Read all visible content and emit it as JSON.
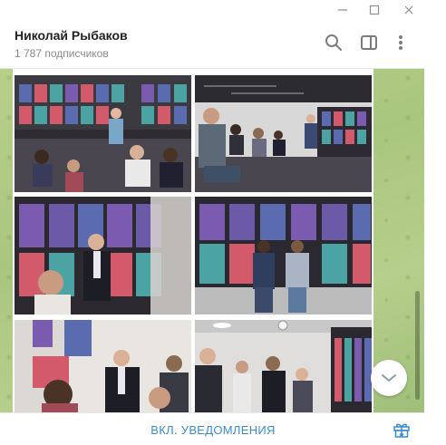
{
  "window": {
    "minimize_icon": "minimize-icon",
    "maximize_icon": "maximize-icon",
    "close_icon": "close-icon"
  },
  "header": {
    "title": "Николай Рыбаков",
    "subtitle": "1 787 подписчиков",
    "search_icon": "search-icon",
    "sidebar_icon": "sidebar-toggle-icon",
    "more_icon": "more-vertical-icon"
  },
  "album": {
    "photos": [
      {
        "description_icon": "photo-audience-exhibition"
      },
      {
        "description_icon": "photo-speaker-hall"
      },
      {
        "description_icon": "photo-speaker-microphone"
      },
      {
        "description_icon": "photo-visitors-stands"
      },
      {
        "description_icon": "photo-guests-conversation"
      },
      {
        "description_icon": "photo-gallery-visitors"
      }
    ]
  },
  "footer": {
    "notify_label": "ВКЛ. УВЕДОМЛЕНИЯ",
    "gift_icon": "gift-icon"
  },
  "colors": {
    "accent": "#3a8bd0",
    "background_chat": "#a9c67f"
  }
}
